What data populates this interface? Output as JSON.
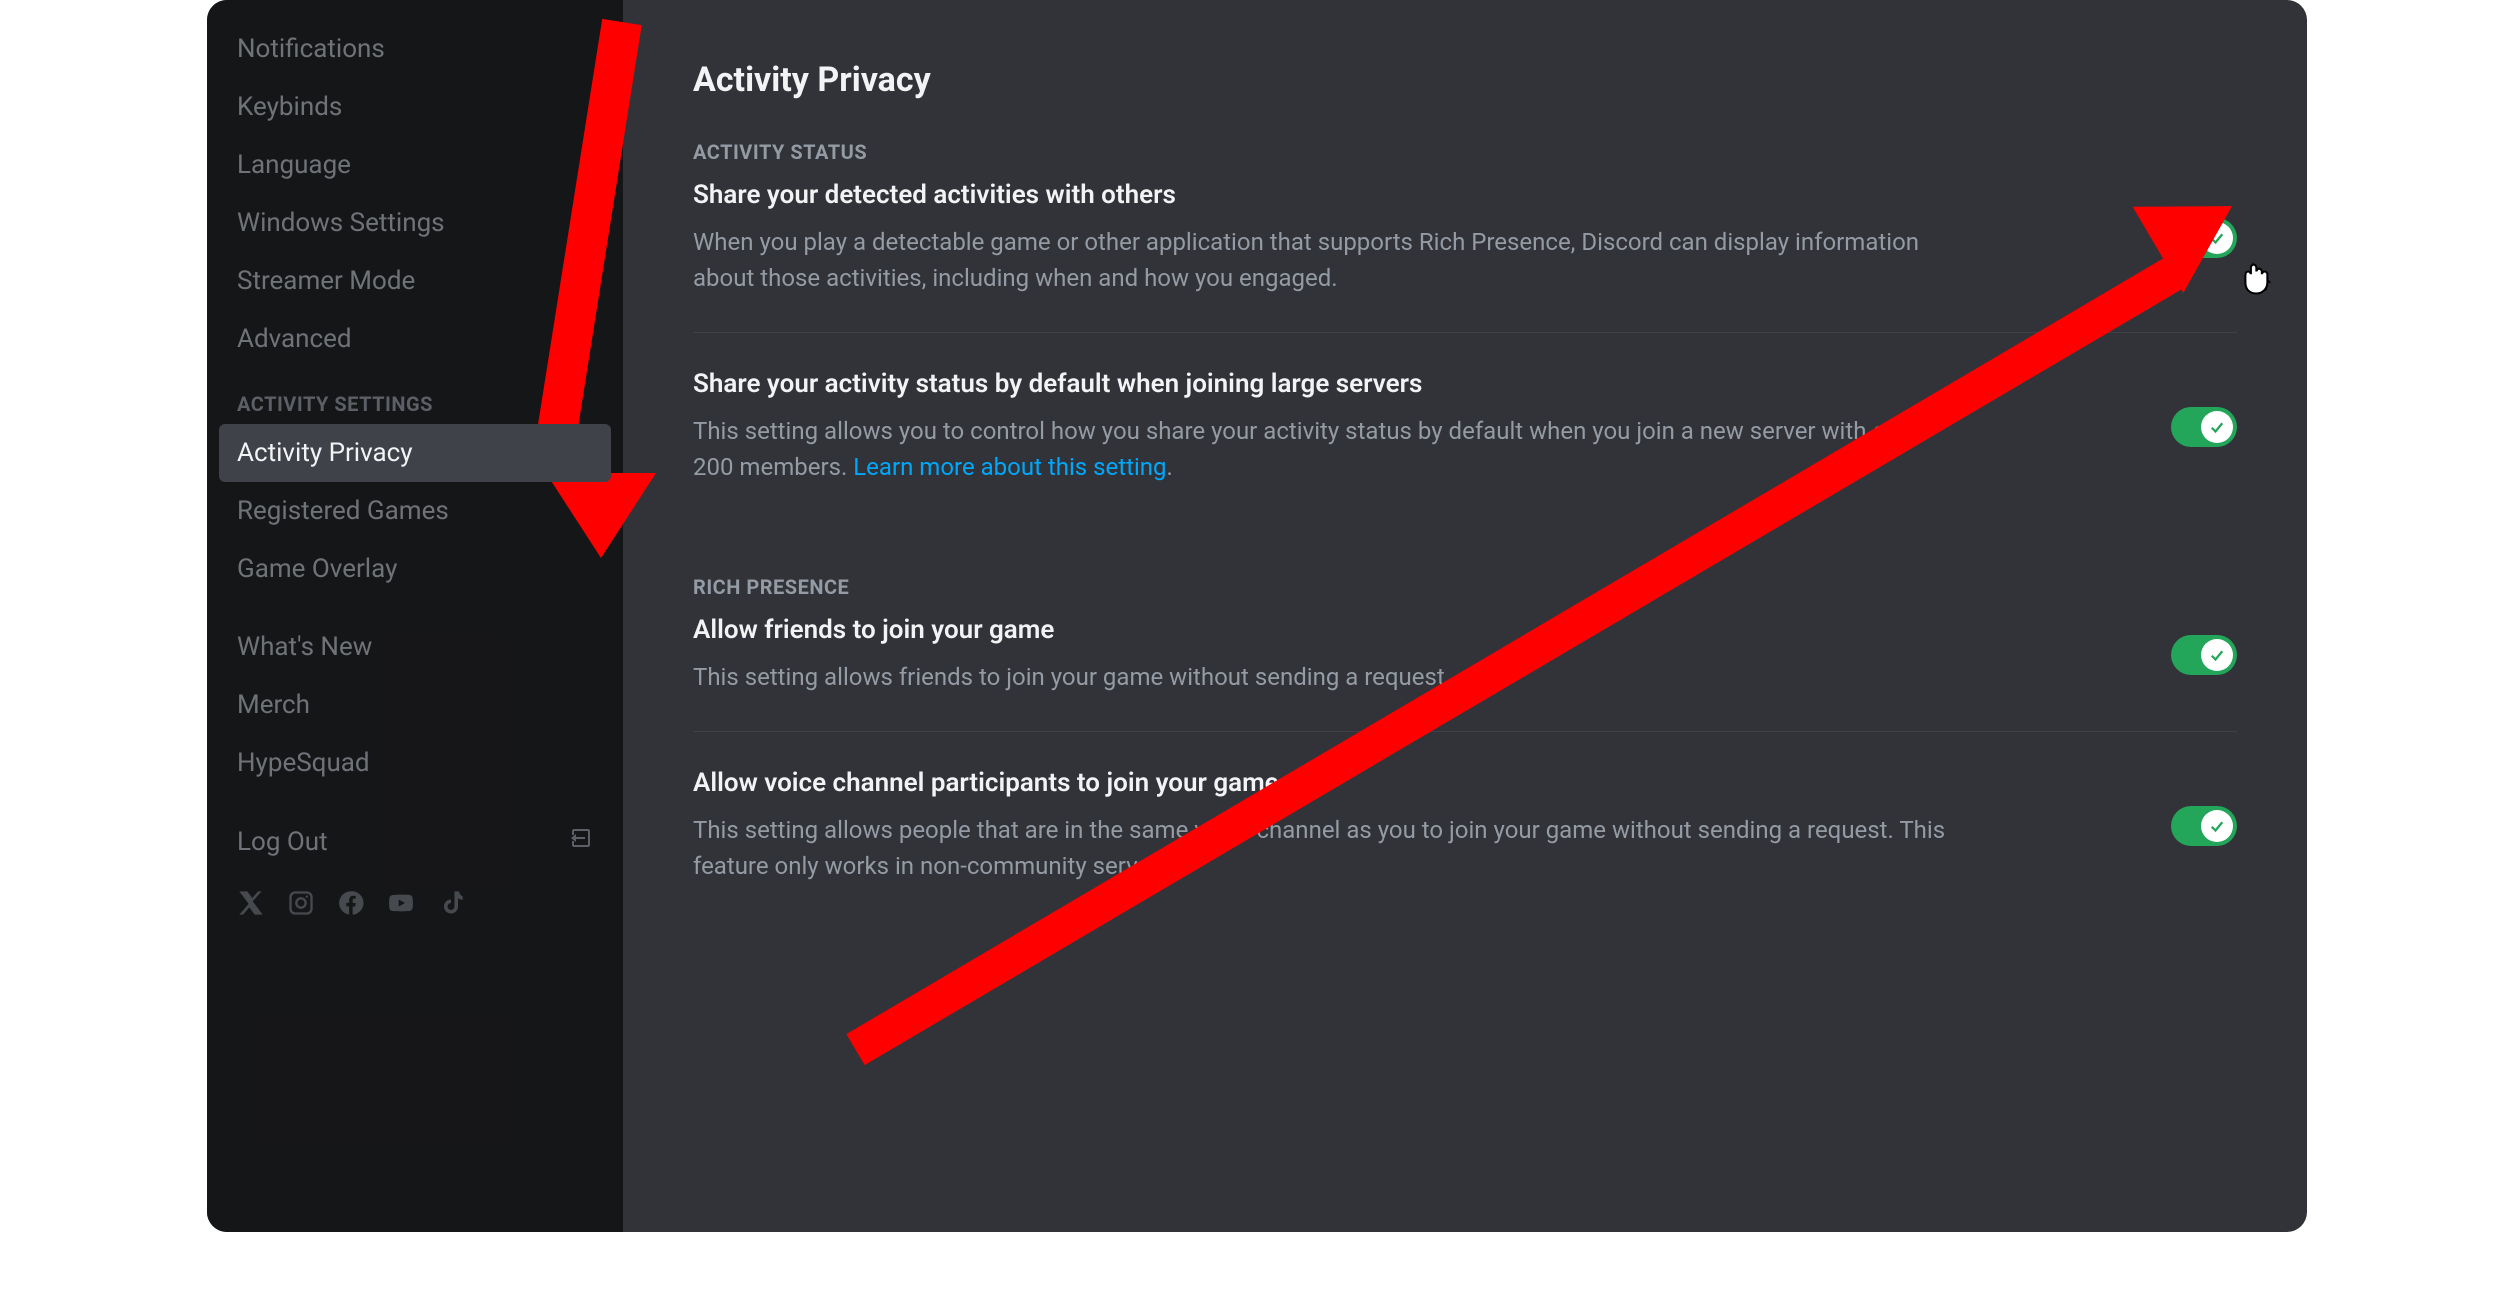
{
  "sidebar": {
    "items_top": [
      {
        "label": "Notifications"
      },
      {
        "label": "Keybinds"
      },
      {
        "label": "Language"
      },
      {
        "label": "Windows Settings"
      },
      {
        "label": "Streamer Mode"
      },
      {
        "label": "Advanced"
      }
    ],
    "activity_header": "ACTIVITY SETTINGS",
    "items_activity": [
      {
        "label": "Activity Privacy",
        "active": true
      },
      {
        "label": "Registered Games"
      },
      {
        "label": "Game Overlay"
      }
    ],
    "items_bottom": [
      {
        "label": "What's New"
      },
      {
        "label": "Merch"
      },
      {
        "label": "HypeSquad"
      }
    ],
    "logout_label": "Log Out"
  },
  "main": {
    "title": "Activity Privacy",
    "section1_header": "ACTIVITY STATUS",
    "setting1": {
      "title": "Share your detected activities with others",
      "desc": "When you play a detectable game or other application that supports Rich Presence, Discord can display information about those activities, including when and how you engaged."
    },
    "setting2": {
      "title": "Share your activity status by default when joining large servers",
      "desc_pre": "This setting allows you to control how you share your activity status by default when you join a new server with over 200 members. ",
      "link": "Learn more about this setting",
      "desc_post": "."
    },
    "section2_header": "RICH PRESENCE",
    "setting3": {
      "title": "Allow friends to join your game",
      "desc": "This setting allows friends to join your game without sending a request."
    },
    "setting4": {
      "title": "Allow voice channel participants to join your game",
      "desc": "This setting allows people that are in the same voice channel as you to join your game without sending a request. This feature only works in non-community servers."
    }
  }
}
